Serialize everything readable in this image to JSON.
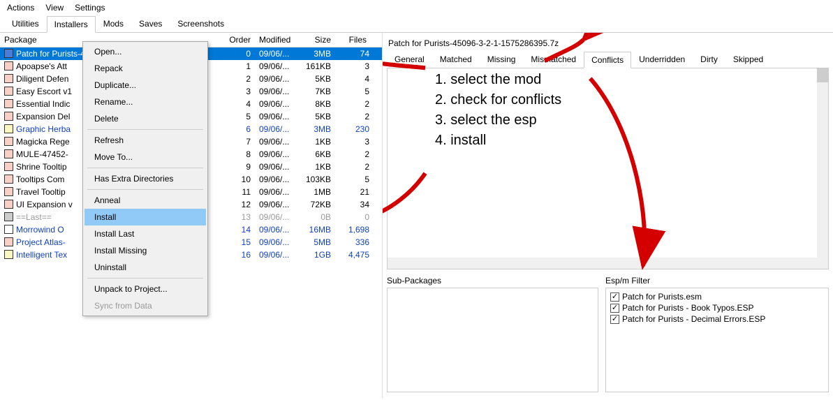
{
  "menubar": [
    "Actions",
    "View",
    "Settings"
  ],
  "tabs": [
    "Utilities",
    "Installers",
    "Mods",
    "Saves",
    "Screenshots"
  ],
  "active_tab": "Installers",
  "columns": {
    "package": "Package",
    "order": "Order",
    "modified": "Modified",
    "size": "Size",
    "files": "Files"
  },
  "packages": [
    {
      "name": "Patch for Purists-45096-3-2-1-1575286395.7z",
      "order": "0",
      "modified": "09/06/...",
      "size": "3MB",
      "files": "74",
      "chk": "blue",
      "selected": true
    },
    {
      "name": "Apoapse's Att",
      "order": "1",
      "modified": "09/06/...",
      "size": "161KB",
      "files": "3",
      "chk": "pink"
    },
    {
      "name": "Diligent Defen",
      "order": "2",
      "modified": "09/06/...",
      "size": "5KB",
      "files": "4",
      "chk": "pink"
    },
    {
      "name": "Easy Escort v1",
      "order": "3",
      "modified": "09/06/...",
      "size": "7KB",
      "files": "5",
      "chk": "pink"
    },
    {
      "name": "Essential Indic",
      "order": "4",
      "modified": "09/06/...",
      "size": "8KB",
      "files": "2",
      "chk": "pink"
    },
    {
      "name": "Expansion Del",
      "order": "5",
      "modified": "09/06/...",
      "size": "5KB",
      "files": "2",
      "chk": "pink"
    },
    {
      "name": "Graphic Herba",
      "order": "6",
      "modified": "09/06/...",
      "size": "3MB",
      "files": "230",
      "chk": "yellow",
      "blue": true
    },
    {
      "name": "Magicka Rege",
      "order": "7",
      "modified": "09/06/...",
      "size": "1KB",
      "files": "3",
      "chk": "pink"
    },
    {
      "name": "MULE-47452-",
      "order": "8",
      "modified": "09/06/...",
      "size": "6KB",
      "files": "2",
      "chk": "pink"
    },
    {
      "name": "Shrine Tooltip",
      "order": "9",
      "modified": "09/06/...",
      "size": "1KB",
      "files": "2",
      "chk": "pink"
    },
    {
      "name": "Tooltips Com",
      "order": "10",
      "modified": "09/06/...",
      "size": "103KB",
      "files": "5",
      "chk": "pink"
    },
    {
      "name": "Travel Tooltip",
      "order": "11",
      "modified": "09/06/...",
      "size": "1MB",
      "files": "21",
      "chk": "pink"
    },
    {
      "name": "UI Expansion v",
      "order": "12",
      "modified": "09/06/...",
      "size": "72KB",
      "files": "34",
      "chk": "pink"
    },
    {
      "name": "==Last==",
      "order": "13",
      "modified": "09/06/...",
      "size": "0B",
      "files": "0",
      "chk": "gray",
      "gray": true
    },
    {
      "name": "Morrowind O",
      "order": "14",
      "modified": "09/06/...",
      "size": "16MB",
      "files": "1,698",
      "chk": "white",
      "blue": true
    },
    {
      "name": "Project Atlas-",
      "order": "15",
      "modified": "09/06/...",
      "size": "5MB",
      "files": "336",
      "chk": "pink",
      "blue": true
    },
    {
      "name": "Intelligent Tex",
      "order": "16",
      "modified": "09/06/...",
      "size": "1GB",
      "files": "4,475",
      "chk": "yellow",
      "blue": true
    }
  ],
  "context_menu": [
    {
      "label": "Open..."
    },
    {
      "label": "Repack"
    },
    {
      "label": "Duplicate..."
    },
    {
      "label": "Rename..."
    },
    {
      "label": "Delete"
    },
    {
      "sep": true
    },
    {
      "label": "Refresh"
    },
    {
      "label": "Move To..."
    },
    {
      "sep": true
    },
    {
      "label": "Has Extra Directories"
    },
    {
      "sep": true
    },
    {
      "label": "Anneal"
    },
    {
      "label": "Install",
      "highlighted": true
    },
    {
      "label": "Install Last"
    },
    {
      "label": "Install Missing"
    },
    {
      "label": "Uninstall"
    },
    {
      "sep": true
    },
    {
      "label": "Unpack to Project..."
    },
    {
      "label": "Sync from Data",
      "disabled": true
    }
  ],
  "right": {
    "title": "Patch for Purists-45096-3-2-1-1575286395.7z",
    "tabs": [
      "General",
      "Matched",
      "Missing",
      "Mismatched",
      "Conflicts",
      "Underridden",
      "Dirty",
      "Skipped"
    ],
    "active_tab": "Conflicts",
    "sub_packages_label": "Sub-Packages",
    "esp_filter_label": "Esp/m Filter",
    "esp_items": [
      "Patch for Purists.esm",
      "Patch for Purists - Book Typos.ESP",
      "Patch for Purists - Decimal Errors.ESP"
    ]
  },
  "annotations": {
    "step1": "1. select the mod",
    "step2": "2. check for conflicts",
    "step3": "3. select the esp",
    "step4": "4. install"
  }
}
